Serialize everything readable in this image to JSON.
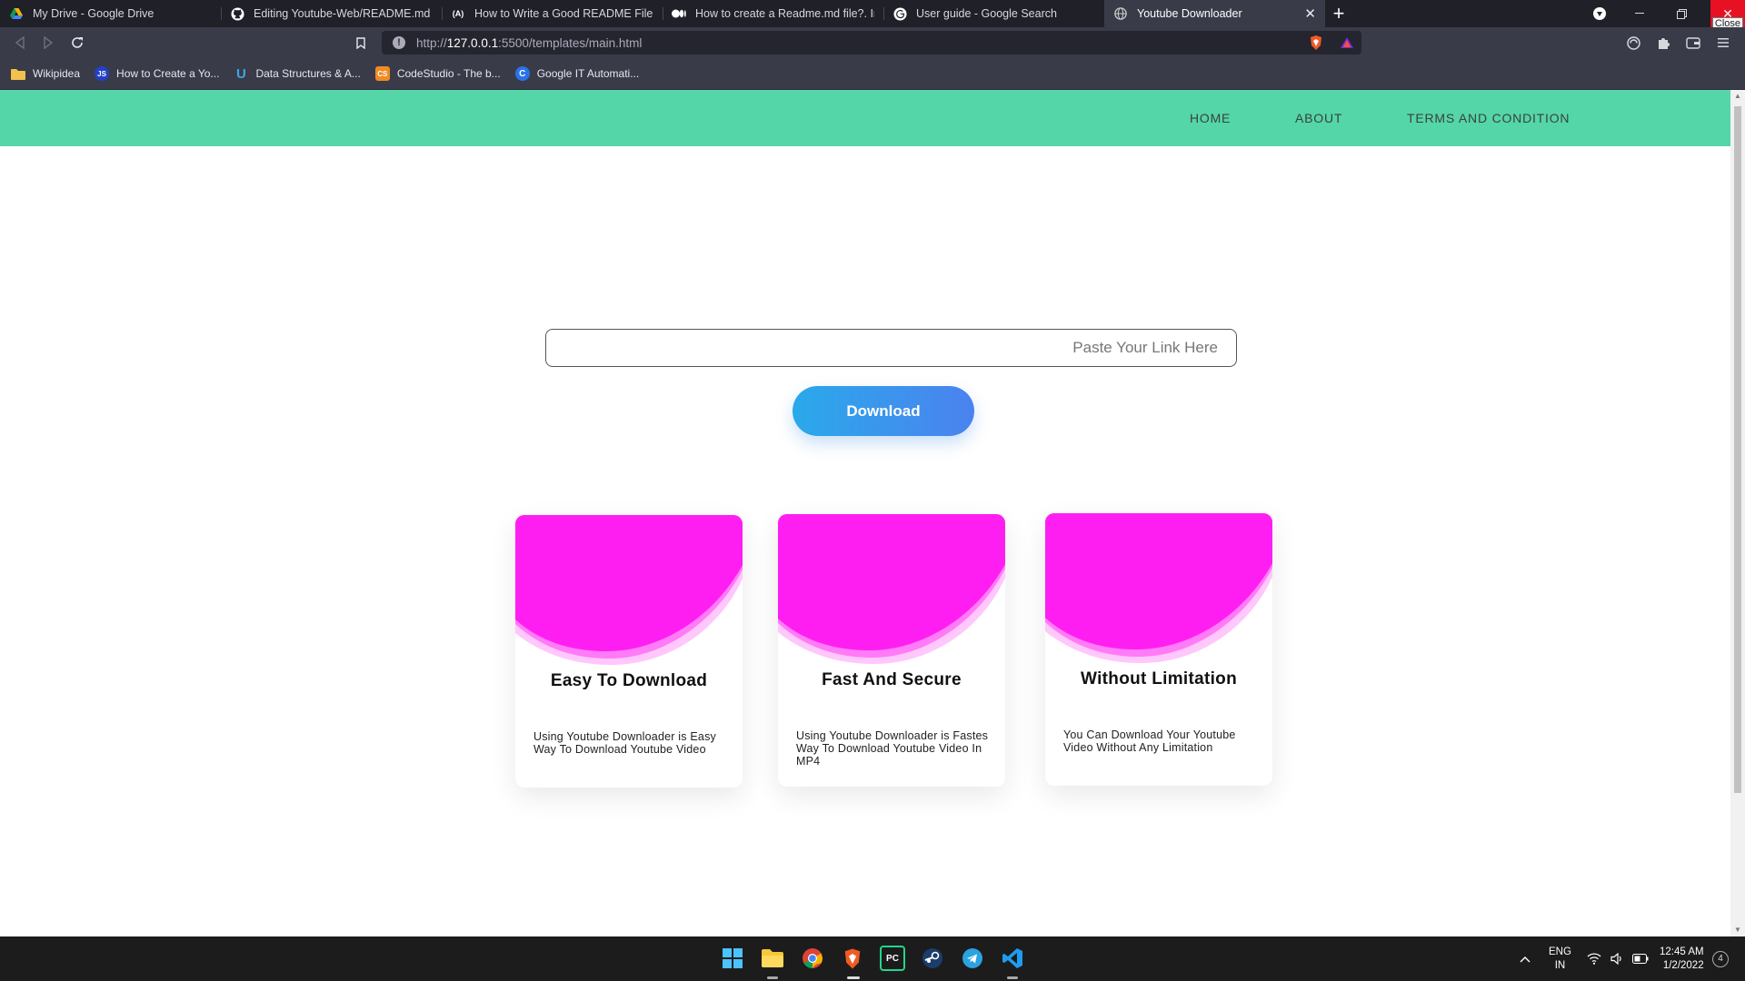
{
  "browser": {
    "tabs": [
      {
        "label": "My Drive - Google Drive",
        "icon": "google-drive-icon",
        "color": "#f4b400"
      },
      {
        "label": "Editing Youtube-Web/README.md at",
        "icon": "github-icon",
        "color": "#ffffff"
      },
      {
        "label": "How to Write a Good README File for",
        "icon": "freecodecamp-icon",
        "color": "#ffffff",
        "fav_text": "(A)"
      },
      {
        "label": "How to create a Readme.md file?. In th",
        "icon": "medium-icon",
        "color": "#ffffff"
      },
      {
        "label": "User guide - Google Search",
        "icon": "google-icon",
        "color": "#ffffff"
      },
      {
        "label": "Youtube Downloader",
        "icon": "globe-icon",
        "color": "#cccccc",
        "active": true
      }
    ],
    "close_tooltip": "Close",
    "url": {
      "prefix": "http://",
      "host": "127.0.0.1",
      "rest": ":5500/templates/main.html"
    },
    "bookmarks": [
      {
        "label": "Wikipidea",
        "icon": "folder-icon",
        "color": "#f2c14e"
      },
      {
        "label": "How to Create a Yo...",
        "icon": "js-icon",
        "color": "#2340c8",
        "text": "JS"
      },
      {
        "label": "Data Structures & A...",
        "icon": "udemy-icon",
        "color": "#3ea6e0",
        "text": "U"
      },
      {
        "label": "CodeStudio - The b...",
        "icon": "codestudio-icon",
        "color": "#f08a24",
        "text": "CS"
      },
      {
        "label": "Google IT Automati...",
        "icon": "coursera-icon",
        "color": "#2a73e8",
        "text": "C"
      }
    ]
  },
  "site": {
    "nav": [
      "HOME",
      "ABOUT",
      "TERMS AND CONDITION"
    ],
    "search": {
      "placeholder": "Paste Your Link Here",
      "value": ""
    },
    "download_label": "Download",
    "cards": [
      {
        "title": "Easy To Download",
        "text": "Using Youtube Downloader is Easy Way To Download Youtube Video"
      },
      {
        "title": "Fast And Secure",
        "text": "Using Youtube Downloader is Fastes Way To Download Youtube Video In MP4"
      },
      {
        "title": "Without Limitation",
        "text": "You Can Download Your Youtube Video Without Any Limitation"
      }
    ],
    "colors": {
      "nav": "#54d6a8",
      "card_wave": "#ff1ef2",
      "button_start": "#2aa9ea",
      "button_end": "#4b82ef"
    }
  },
  "taskbar": {
    "apps": [
      "windows-start-icon",
      "file-explorer-icon",
      "chrome-icon",
      "brave-icon",
      "pycharm-icon",
      "steam-icon",
      "telegram-icon",
      "vscode-icon"
    ],
    "language": {
      "line1": "ENG",
      "line2": "IN"
    },
    "time": "12:45 AM",
    "date": "1/2/2022",
    "notifications": "4"
  }
}
